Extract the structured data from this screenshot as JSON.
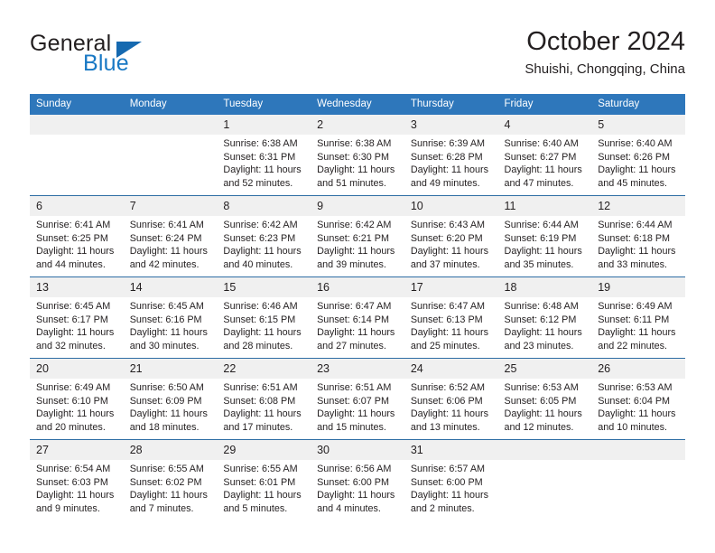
{
  "brand": {
    "name_part1": "General",
    "name_part2": "Blue",
    "triangle_color": "#1569b0",
    "blue_color": "#1878c4"
  },
  "header": {
    "title": "October 2024",
    "subtitle": "Shuishi, Chongqing, China"
  },
  "calendar": {
    "header_bg": "#2e77bb",
    "row_line_color": "#2e6da4",
    "daynum_bg": "#f0f0f0",
    "weekdays": [
      "Sunday",
      "Monday",
      "Tuesday",
      "Wednesday",
      "Thursday",
      "Friday",
      "Saturday"
    ],
    "labels": {
      "sunrise": "Sunrise:",
      "sunset": "Sunset:",
      "daylight": "Daylight:"
    },
    "weeks": [
      [
        {
          "day": "",
          "sunrise": "",
          "sunset": "",
          "daylight": ""
        },
        {
          "day": "",
          "sunrise": "",
          "sunset": "",
          "daylight": ""
        },
        {
          "day": "1",
          "sunrise": "Sunrise: 6:38 AM",
          "sunset": "Sunset: 6:31 PM",
          "daylight": "Daylight: 11 hours and 52 minutes."
        },
        {
          "day": "2",
          "sunrise": "Sunrise: 6:38 AM",
          "sunset": "Sunset: 6:30 PM",
          "daylight": "Daylight: 11 hours and 51 minutes."
        },
        {
          "day": "3",
          "sunrise": "Sunrise: 6:39 AM",
          "sunset": "Sunset: 6:28 PM",
          "daylight": "Daylight: 11 hours and 49 minutes."
        },
        {
          "day": "4",
          "sunrise": "Sunrise: 6:40 AM",
          "sunset": "Sunset: 6:27 PM",
          "daylight": "Daylight: 11 hours and 47 minutes."
        },
        {
          "day": "5",
          "sunrise": "Sunrise: 6:40 AM",
          "sunset": "Sunset: 6:26 PM",
          "daylight": "Daylight: 11 hours and 45 minutes."
        }
      ],
      [
        {
          "day": "6",
          "sunrise": "Sunrise: 6:41 AM",
          "sunset": "Sunset: 6:25 PM",
          "daylight": "Daylight: 11 hours and 44 minutes."
        },
        {
          "day": "7",
          "sunrise": "Sunrise: 6:41 AM",
          "sunset": "Sunset: 6:24 PM",
          "daylight": "Daylight: 11 hours and 42 minutes."
        },
        {
          "day": "8",
          "sunrise": "Sunrise: 6:42 AM",
          "sunset": "Sunset: 6:23 PM",
          "daylight": "Daylight: 11 hours and 40 minutes."
        },
        {
          "day": "9",
          "sunrise": "Sunrise: 6:42 AM",
          "sunset": "Sunset: 6:21 PM",
          "daylight": "Daylight: 11 hours and 39 minutes."
        },
        {
          "day": "10",
          "sunrise": "Sunrise: 6:43 AM",
          "sunset": "Sunset: 6:20 PM",
          "daylight": "Daylight: 11 hours and 37 minutes."
        },
        {
          "day": "11",
          "sunrise": "Sunrise: 6:44 AM",
          "sunset": "Sunset: 6:19 PM",
          "daylight": "Daylight: 11 hours and 35 minutes."
        },
        {
          "day": "12",
          "sunrise": "Sunrise: 6:44 AM",
          "sunset": "Sunset: 6:18 PM",
          "daylight": "Daylight: 11 hours and 33 minutes."
        }
      ],
      [
        {
          "day": "13",
          "sunrise": "Sunrise: 6:45 AM",
          "sunset": "Sunset: 6:17 PM",
          "daylight": "Daylight: 11 hours and 32 minutes."
        },
        {
          "day": "14",
          "sunrise": "Sunrise: 6:45 AM",
          "sunset": "Sunset: 6:16 PM",
          "daylight": "Daylight: 11 hours and 30 minutes."
        },
        {
          "day": "15",
          "sunrise": "Sunrise: 6:46 AM",
          "sunset": "Sunset: 6:15 PM",
          "daylight": "Daylight: 11 hours and 28 minutes."
        },
        {
          "day": "16",
          "sunrise": "Sunrise: 6:47 AM",
          "sunset": "Sunset: 6:14 PM",
          "daylight": "Daylight: 11 hours and 27 minutes."
        },
        {
          "day": "17",
          "sunrise": "Sunrise: 6:47 AM",
          "sunset": "Sunset: 6:13 PM",
          "daylight": "Daylight: 11 hours and 25 minutes."
        },
        {
          "day": "18",
          "sunrise": "Sunrise: 6:48 AM",
          "sunset": "Sunset: 6:12 PM",
          "daylight": "Daylight: 11 hours and 23 minutes."
        },
        {
          "day": "19",
          "sunrise": "Sunrise: 6:49 AM",
          "sunset": "Sunset: 6:11 PM",
          "daylight": "Daylight: 11 hours and 22 minutes."
        }
      ],
      [
        {
          "day": "20",
          "sunrise": "Sunrise: 6:49 AM",
          "sunset": "Sunset: 6:10 PM",
          "daylight": "Daylight: 11 hours and 20 minutes."
        },
        {
          "day": "21",
          "sunrise": "Sunrise: 6:50 AM",
          "sunset": "Sunset: 6:09 PM",
          "daylight": "Daylight: 11 hours and 18 minutes."
        },
        {
          "day": "22",
          "sunrise": "Sunrise: 6:51 AM",
          "sunset": "Sunset: 6:08 PM",
          "daylight": "Daylight: 11 hours and 17 minutes."
        },
        {
          "day": "23",
          "sunrise": "Sunrise: 6:51 AM",
          "sunset": "Sunset: 6:07 PM",
          "daylight": "Daylight: 11 hours and 15 minutes."
        },
        {
          "day": "24",
          "sunrise": "Sunrise: 6:52 AM",
          "sunset": "Sunset: 6:06 PM",
          "daylight": "Daylight: 11 hours and 13 minutes."
        },
        {
          "day": "25",
          "sunrise": "Sunrise: 6:53 AM",
          "sunset": "Sunset: 6:05 PM",
          "daylight": "Daylight: 11 hours and 12 minutes."
        },
        {
          "day": "26",
          "sunrise": "Sunrise: 6:53 AM",
          "sunset": "Sunset: 6:04 PM",
          "daylight": "Daylight: 11 hours and 10 minutes."
        }
      ],
      [
        {
          "day": "27",
          "sunrise": "Sunrise: 6:54 AM",
          "sunset": "Sunset: 6:03 PM",
          "daylight": "Daylight: 11 hours and 9 minutes."
        },
        {
          "day": "28",
          "sunrise": "Sunrise: 6:55 AM",
          "sunset": "Sunset: 6:02 PM",
          "daylight": "Daylight: 11 hours and 7 minutes."
        },
        {
          "day": "29",
          "sunrise": "Sunrise: 6:55 AM",
          "sunset": "Sunset: 6:01 PM",
          "daylight": "Daylight: 11 hours and 5 minutes."
        },
        {
          "day": "30",
          "sunrise": "Sunrise: 6:56 AM",
          "sunset": "Sunset: 6:00 PM",
          "daylight": "Daylight: 11 hours and 4 minutes."
        },
        {
          "day": "31",
          "sunrise": "Sunrise: 6:57 AM",
          "sunset": "Sunset: 6:00 PM",
          "daylight": "Daylight: 11 hours and 2 minutes."
        },
        {
          "day": "",
          "sunrise": "",
          "sunset": "",
          "daylight": ""
        },
        {
          "day": "",
          "sunrise": "",
          "sunset": "",
          "daylight": ""
        }
      ]
    ]
  }
}
